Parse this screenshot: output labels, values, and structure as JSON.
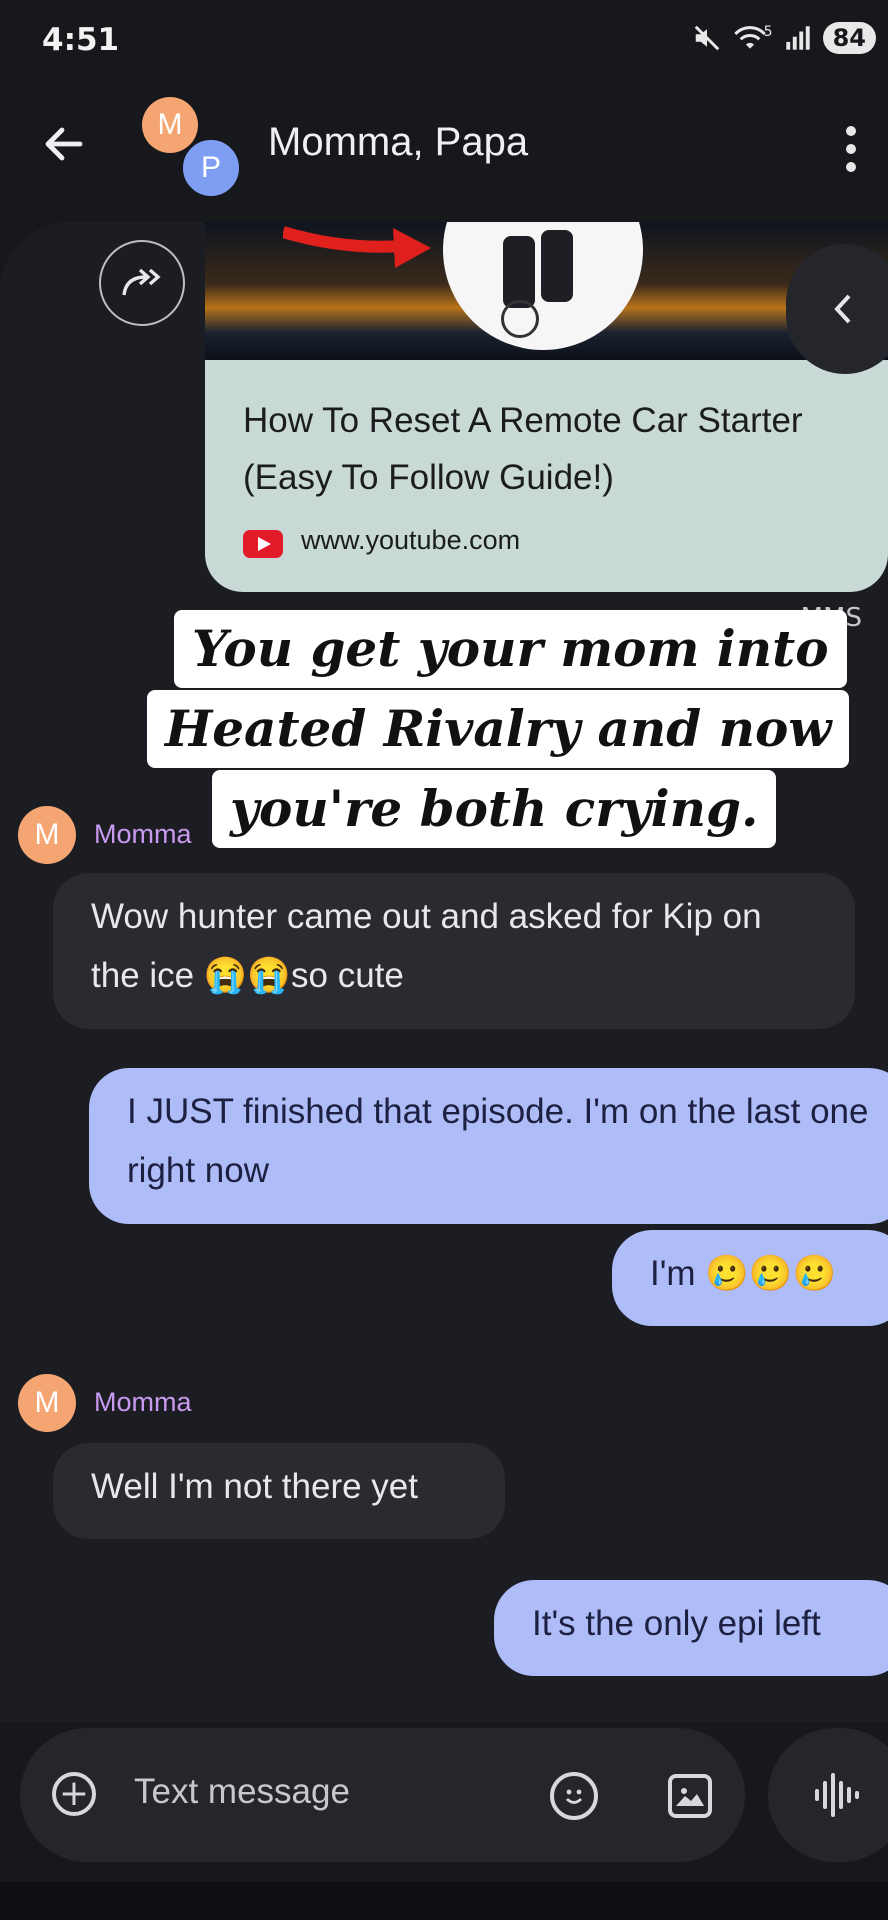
{
  "status_bar": {
    "time": "4:51",
    "battery": "84",
    "network": "5"
  },
  "header": {
    "title": "Momma, Papa",
    "avatars": [
      {
        "initial": "M",
        "color": "#f5a572"
      },
      {
        "initial": "P",
        "color": "#7e9ef4"
      }
    ]
  },
  "link_preview": {
    "title": "How To Reset A Remote Car Starter (Easy To Follow Guide!)",
    "url": "www.youtube.com",
    "badge": "MMS"
  },
  "caption": {
    "line1": "You get your mom into",
    "line2": "Heated Rivalry and now",
    "line3": "you're both crying."
  },
  "messages": [
    {
      "sender": "Momma",
      "avatar": "M",
      "text": "Wow hunter came out and asked for Kip on the ice 😭😭so cute"
    },
    {
      "from_me": true,
      "text": "I JUST finished that episode. I'm on the last one right now"
    },
    {
      "from_me": true,
      "text": "I'm 🥲🥲🥲"
    },
    {
      "sender": "Momma",
      "avatar": "M",
      "text": "Well I'm not there yet"
    },
    {
      "from_me": true,
      "text": "It's the only epi left"
    }
  ],
  "compose": {
    "placeholder": "Text message"
  },
  "colors": {
    "background": "#17181c",
    "incoming_bubble": "#2a2b30",
    "outgoing_bubble": "#aebcf8",
    "sender_name": "#c99bf0"
  },
  "icons": [
    "back-arrow-icon",
    "more-vert-icon",
    "share-forward-icon",
    "chevron-left-icon",
    "youtube-icon",
    "add-icon",
    "emoji-icon",
    "gallery-icon",
    "voice-icon",
    "mute-icon",
    "wifi-icon",
    "signal-icon"
  ]
}
